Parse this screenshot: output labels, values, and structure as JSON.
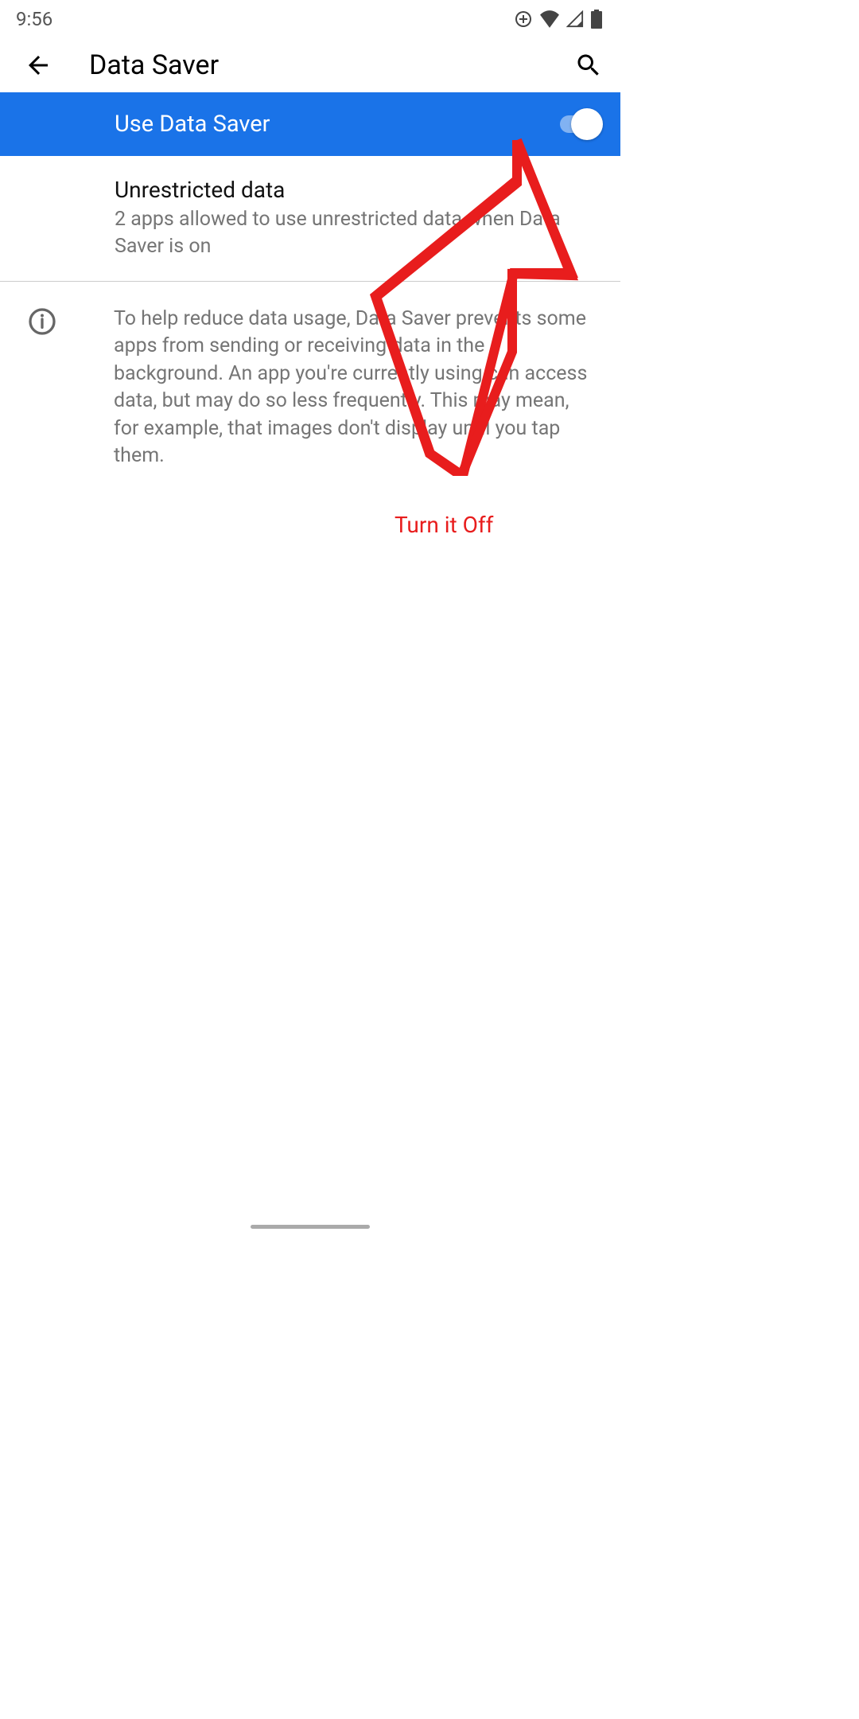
{
  "status_bar": {
    "time": "9:56"
  },
  "app_bar": {
    "title": "Data Saver"
  },
  "toggle": {
    "label": "Use Data Saver"
  },
  "unrestricted": {
    "title": "Unrestricted data",
    "subtitle": "2 apps allowed to use unrestricted data when Data Saver is on"
  },
  "info": {
    "text": "To help reduce data usage, Data Saver prevents some apps from sending or receiving data in the background. An app you're currently using can access data, but may do so less frequently. This may mean, for example, that images don't display until you tap them."
  },
  "annotation": {
    "label": "Turn it Off"
  }
}
